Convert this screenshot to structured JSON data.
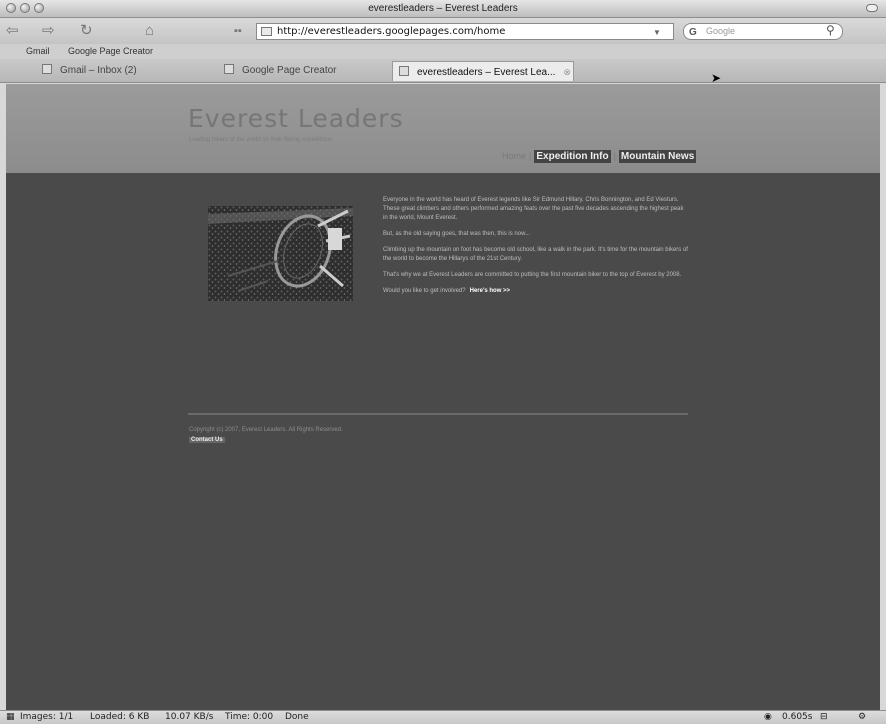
{
  "window": {
    "title": "everestleaders – Everest Leaders"
  },
  "toolbar": {
    "back_label": "⇦",
    "forward_label": "⇨",
    "reload_label": "↻",
    "home_label": "⌂",
    "url": "http://everestleaders.googlepages.com/home",
    "search_placeholder": "Google",
    "search_engine_glyph": "G"
  },
  "bookmarks": {
    "items": [
      "Gmail",
      "Google Page Creator"
    ]
  },
  "tabs": [
    {
      "label": "Gmail – Inbox (2)",
      "active": false
    },
    {
      "label": "Google Page Creator",
      "active": false
    },
    {
      "label": "everestleaders – Everest Lea...",
      "active": true
    }
  ],
  "site": {
    "title": "Everest Leaders",
    "tagline": "Leading bikers of the world on their Biking expeditions",
    "nav": [
      "Home",
      "Expedition Info",
      "Mountain News"
    ],
    "paragraphs": [
      "Everyone in the world has heard of Everest legends like Sir Edmund Hillary, Chris Bonnington, and Ed Viesturs. These great climbers and others performed amazing feats over the past five decades ascending the highest peak in the world, Mount Everest.",
      "But, as the old saying goes, that was then, this is now...",
      "Climbing up the mountain on foot has become old school, like a walk in the park. It's time for the mountain bikers of the world to become the Hillarys of the 21st Century.",
      "That's why we at Everest Leaders are committed to putting the first mountain biker to the top of Everest by 2008."
    ],
    "cta_question": "Would you like to get involved?",
    "cta_link": "Here's how >>",
    "copyright": "Copyright (c) 2007, Everest Leaders. All Rights Reserved.",
    "contact": "Contact Us"
  },
  "status": {
    "images": "Images: 1/1",
    "loaded": "Loaded: 6 KB",
    "speed": "10.07 KB/s",
    "time": "Time: 0:00",
    "state": "Done",
    "timing": "0.605s"
  }
}
